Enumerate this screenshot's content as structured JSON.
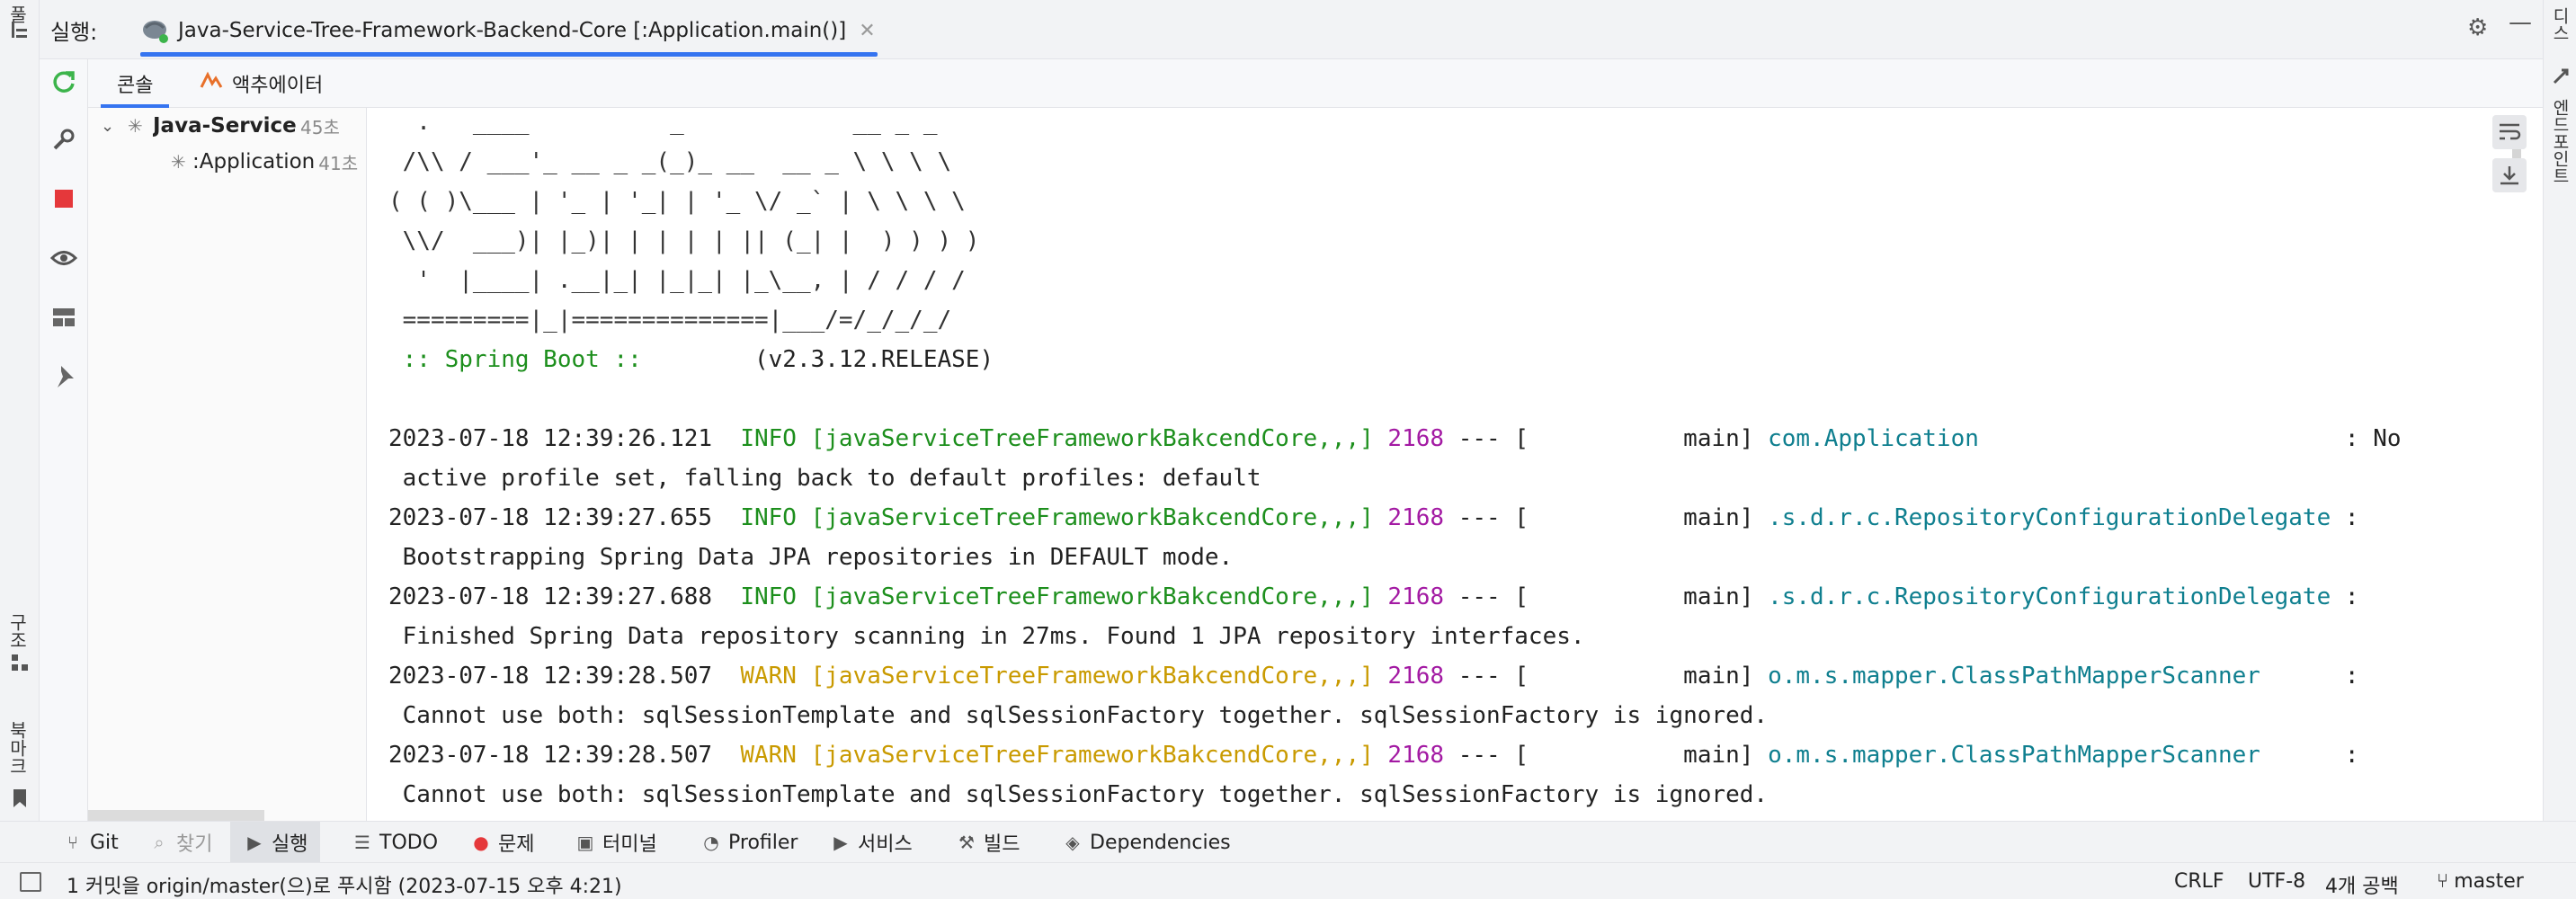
{
  "header": {
    "label": "실행:",
    "tab_title": "Java-Service-Tree-Framework-Backend-Core [:Application.main()]",
    "accent_color": "#3574f0"
  },
  "subtabs": [
    {
      "label": "콘솔",
      "active": true
    },
    {
      "label": "액추에이터",
      "active": false
    }
  ],
  "left_gutter": {
    "top_label": "풀",
    "structure_label": "구조",
    "bookmarks_label": "북마크"
  },
  "right_gutter": {
    "top_label": "디스",
    "bottom_label": "엔드포인트"
  },
  "tree": {
    "root": {
      "label": "Java-Service-T",
      "time": "45초"
    },
    "child": {
      "label": ":Application",
      "time": "41초"
    }
  },
  "console": {
    "banner": [
      "  .   ____          _            __ _ _",
      " /\\\\ / ___'_ __ _ _(_)_ __  __ _ \\ \\ \\ \\",
      "( ( )\\___ | '_ | '_| | '_ \\/ _` | \\ \\ \\ \\",
      " \\\\/  ___)| |_)| | | | | || (_| |  ) ) ) )",
      "  '  |____| .__|_| |_|_| |_\\__, | / / / /",
      " =========|_|==============|___/=/_/_/_/"
    ],
    "boot_label": " :: Spring Boot :: ",
    "boot_version": "       (v2.3.12.RELEASE)",
    "logs": [
      {
        "ts": "2023-07-18 12:39:26.121",
        "level": "INFO",
        "thread_ctx": "[javaServiceTreeFrameworkBakcendCore,,,]",
        "pid": "2168",
        "sep": "---",
        "thread": "[           main]",
        "logger": "com.Application",
        "tail": ": No",
        "cont": " active profile set, falling back to default profiles: default"
      },
      {
        "ts": "2023-07-18 12:39:27.655",
        "level": "INFO",
        "thread_ctx": "[javaServiceTreeFrameworkBakcendCore,,,]",
        "pid": "2168",
        "sep": "---",
        "thread": "[           main]",
        "logger": ".s.d.r.c.RepositoryConfigurationDelegate",
        "tail": ":",
        "cont": " Bootstrapping Spring Data JPA repositories in DEFAULT mode."
      },
      {
        "ts": "2023-07-18 12:39:27.688",
        "level": "INFO",
        "thread_ctx": "[javaServiceTreeFrameworkBakcendCore,,,]",
        "pid": "2168",
        "sep": "---",
        "thread": "[           main]",
        "logger": ".s.d.r.c.RepositoryConfigurationDelegate",
        "tail": ":",
        "cont": " Finished Spring Data repository scanning in 27ms. Found 1 JPA repository interfaces."
      },
      {
        "ts": "2023-07-18 12:39:28.507",
        "level": "WARN",
        "thread_ctx": "[javaServiceTreeFrameworkBakcendCore,,,]",
        "pid": "2168",
        "sep": "---",
        "thread": "[           main]",
        "logger": "o.m.s.mapper.ClassPathMapperScanner",
        "tail": ":",
        "cont": " Cannot use both: sqlSessionTemplate and sqlSessionFactory together. sqlSessionFactory is ignored."
      },
      {
        "ts": "2023-07-18 12:39:28.507",
        "level": "WARN",
        "thread_ctx": "[javaServiceTreeFrameworkBakcendCore,,,]",
        "pid": "2168",
        "sep": "---",
        "thread": "[           main]",
        "logger": "o.m.s.mapper.ClassPathMapperScanner",
        "tail": ":",
        "cont": " Cannot use both: sqlSessionTemplate and sqlSessionFactory together. sqlSessionFactory is ignored."
      }
    ]
  },
  "bottom_tools": [
    {
      "icon": "git-icon",
      "label": "Git",
      "active": false
    },
    {
      "icon": "search-icon",
      "label": "찾기",
      "active": false
    },
    {
      "icon": "run-icon",
      "label": "실행",
      "active": true
    },
    {
      "icon": "todo-icon",
      "label": "TODO",
      "active": false
    },
    {
      "icon": "problems-icon",
      "label": "문제",
      "active": false
    },
    {
      "icon": "terminal-icon",
      "label": "터미널",
      "active": false
    },
    {
      "icon": "profiler-icon",
      "label": "Profiler",
      "active": false
    },
    {
      "icon": "services-icon",
      "label": "서비스",
      "active": false
    },
    {
      "icon": "build-icon",
      "label": "빌드",
      "active": false
    },
    {
      "icon": "dependencies-icon",
      "label": "Dependencies",
      "active": false
    }
  ],
  "status_bar": {
    "message": "1 커밋을 origin/master(으)로 푸시함 (2023-07-15 오후 4:21)",
    "line_separator": "CRLF",
    "encoding": "UTF-8",
    "indent": "4개 공백",
    "branch": "master"
  }
}
